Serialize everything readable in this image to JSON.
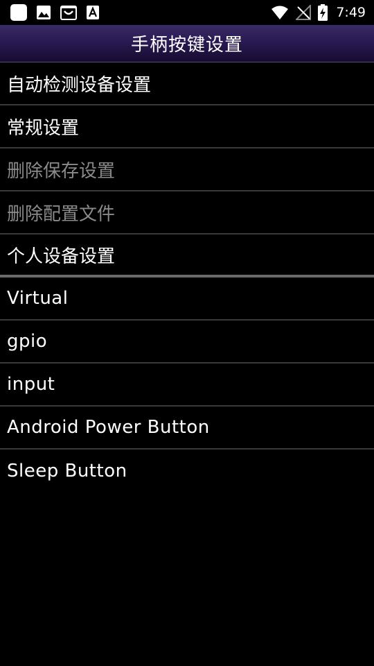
{
  "status_bar": {
    "time": "7:49",
    "left_icons": [
      "square-notification-icon",
      "image-icon",
      "shopping-bag-icon",
      "font-a-icon"
    ],
    "right_icons": [
      "wifi-icon",
      "no-signal-icon",
      "battery-charging-icon"
    ]
  },
  "header": {
    "title": "手柄按键设置",
    "gradient_colors": [
      "#3a2a66",
      "#160b30"
    ]
  },
  "menu": {
    "items": [
      {
        "label": "自动检测设备设置",
        "enabled": true
      },
      {
        "label": "常规设置",
        "enabled": true
      },
      {
        "label": "删除保存设置",
        "enabled": false
      },
      {
        "label": "删除配置文件",
        "enabled": false
      },
      {
        "label": "个人设备设置",
        "enabled": true
      }
    ]
  },
  "devices": {
    "items": [
      {
        "label": "Virtual"
      },
      {
        "label": "gpio"
      },
      {
        "label": "input"
      },
      {
        "label": "Android Power Button"
      },
      {
        "label": "Sleep Button"
      }
    ]
  },
  "colors": {
    "background": "#000000",
    "text": "#ffffff",
    "disabled_text": "#8a8a8a",
    "divider": "#3a3a3a"
  }
}
